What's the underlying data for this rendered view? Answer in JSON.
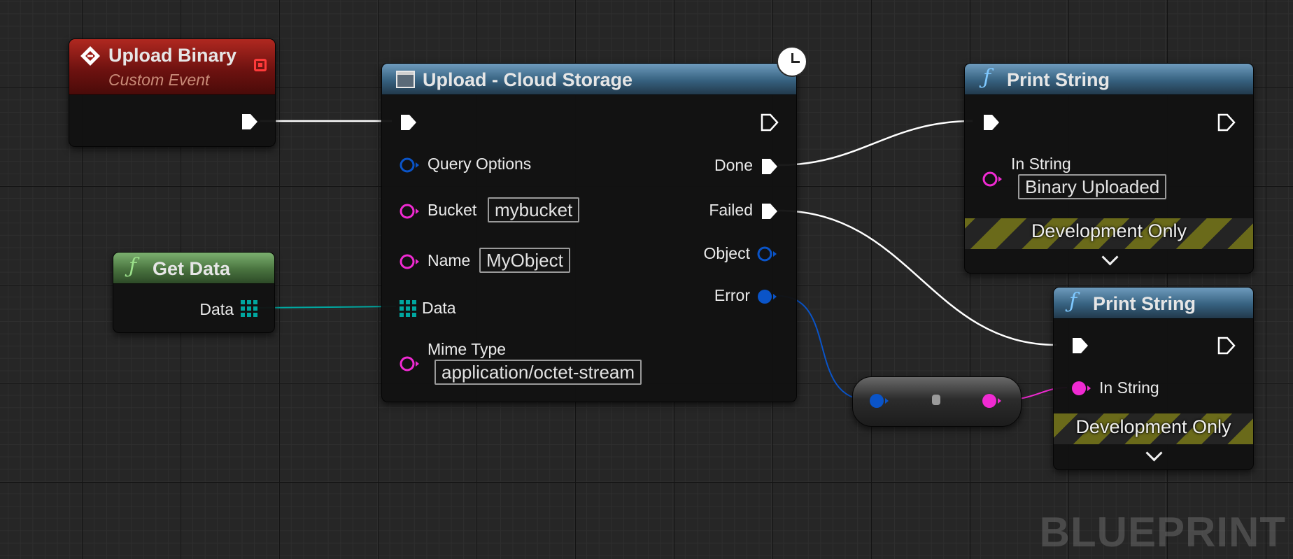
{
  "watermark": "BLUEPRINT",
  "colors": {
    "exec": "#ffffff",
    "struct_blue": "#0a54c8",
    "string_pink": "#f02ad2",
    "data_teal": "#00a7a0",
    "event_header": "#9c1a14",
    "function_header_blue": "#3e7598",
    "pure_header_green": "#5b8c52"
  },
  "nodes": {
    "upload_binary": {
      "title": "Upload Binary",
      "subtitle": "Custom Event",
      "icon": "event-diamond-icon"
    },
    "get_data": {
      "title": "Get Data",
      "icon": "function-icon",
      "data_label": "Data"
    },
    "upload": {
      "title": "Upload - Cloud Storage",
      "icon": "node-window-icon",
      "latent_icon": "clock-icon",
      "inputs": {
        "query_options": "Query Options",
        "bucket_label": "Bucket",
        "bucket_value": "mybucket",
        "name_label": "Name",
        "name_value": "MyObject",
        "data_label": "Data",
        "mime_label": "Mime Type",
        "mime_value": "application/octet-stream"
      },
      "outputs": {
        "done": "Done",
        "failed": "Failed",
        "object": "Object",
        "error": "Error"
      }
    },
    "print1": {
      "title": "Print String",
      "icon": "function-icon",
      "in_string_label": "In String",
      "in_string_value": "Binary Uploaded",
      "dev_only": "Development Only"
    },
    "print2": {
      "title": "Print String",
      "icon": "function-icon",
      "in_string_label": "In String",
      "dev_only": "Development Only"
    },
    "conversion": {
      "icon": "conversion-node-icon"
    }
  }
}
